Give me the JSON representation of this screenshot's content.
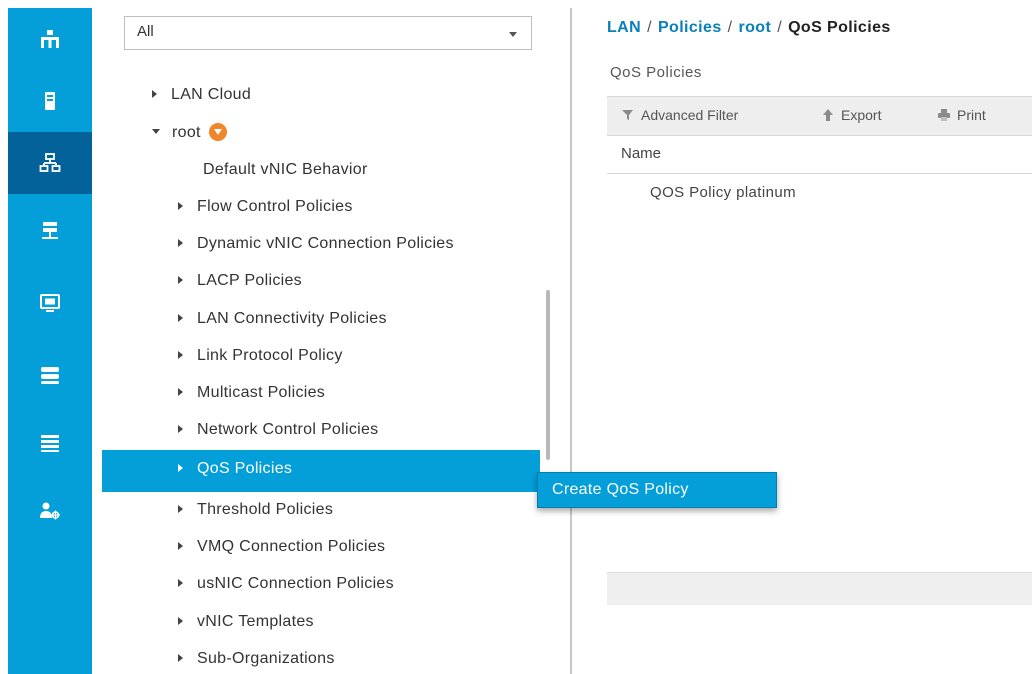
{
  "rail": {
    "items": [
      {
        "icon": "equipment-icon",
        "active": false
      },
      {
        "icon": "servers-icon",
        "active": false
      },
      {
        "icon": "lan-icon",
        "active": true
      },
      {
        "icon": "san-icon",
        "active": false
      },
      {
        "icon": "vm-icon",
        "active": false
      },
      {
        "icon": "storage-icon",
        "active": false
      },
      {
        "icon": "chassis-icon",
        "active": false
      },
      {
        "icon": "admin-icon",
        "active": false
      }
    ]
  },
  "filter": {
    "value": "All"
  },
  "tree": {
    "lan_cloud": "LAN Cloud",
    "root": "root",
    "items": [
      "Default vNIC Behavior",
      "Flow Control Policies",
      "Dynamic vNIC Connection Policies",
      "LACP Policies",
      "LAN Connectivity Policies",
      "Link Protocol Policy",
      "Multicast Policies",
      "Network Control Policies",
      "QoS Policies",
      "Threshold Policies",
      "VMQ Connection Policies",
      "usNIC Connection Policies",
      "vNIC Templates",
      "Sub-Organizations"
    ],
    "selected": "QoS Policies"
  },
  "context_menu": {
    "create_label": "Create QoS Policy"
  },
  "breadcrumb": {
    "items": [
      "LAN",
      "Policies",
      "root"
    ],
    "current": "QoS Policies",
    "separator": "/"
  },
  "content": {
    "section_title": "QoS Policies",
    "toolbar": {
      "filter_label": "Advanced Filter",
      "export_label": "Export",
      "print_label": "Print"
    },
    "table": {
      "columns": [
        "Name"
      ],
      "rows": [
        [
          "QOS Policy platinum"
        ]
      ]
    }
  },
  "colors": {
    "accent": "#049fd9",
    "rail_active": "#03629a",
    "link": "#0a7fb8",
    "org_badge": "#f0852a"
  }
}
